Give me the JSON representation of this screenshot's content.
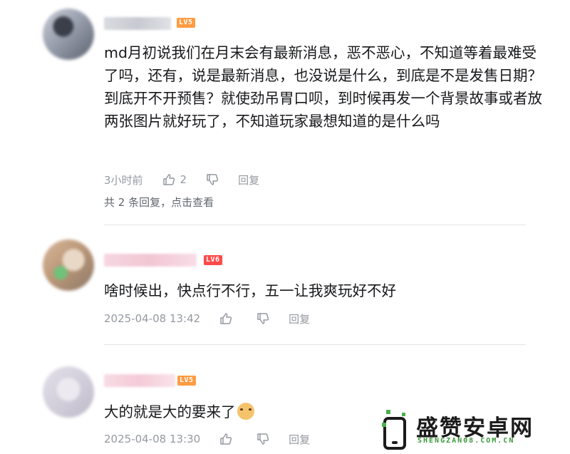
{
  "comments": [
    {
      "level": "LV5",
      "text": "md月初说我们在月末会有最新消息，恶不恶心，不知道等着最难受了吗，还有，说是最新消息，也没说是什么，到底是不是发售日期？到底开不开预售？就使劲吊胃口呗，到时候再发一个背景故事或者放两张图片就好玩了，不知道玩家最想知道的是什么吗",
      "time": "3小时前",
      "likes": "2",
      "reply_label": "回复",
      "replies_summary": "共 2 条回复，点击查看"
    },
    {
      "level": "LV6",
      "text": "啥时候出，快点行不行，五一让我爽玩好不好",
      "time": "2025-04-08 13:42",
      "likes": "",
      "reply_label": "回复"
    },
    {
      "level": "LV5",
      "text": "大的就是大的要来了",
      "time": "2025-04-08 13:30",
      "likes": "",
      "reply_label": "回复"
    }
  ],
  "watermark": {
    "title": "盛赞安卓网",
    "domain": "SHENGZAN08.COM.CN"
  },
  "colors": {
    "lv5": "#ff9b42",
    "lv6": "#ff4a4a",
    "meta": "#9499a0",
    "text": "#18191c"
  },
  "icons": [
    "thumbs-up-icon",
    "thumbs-down-icon",
    "dog-emoji-icon",
    "phone-logo-icon"
  ]
}
